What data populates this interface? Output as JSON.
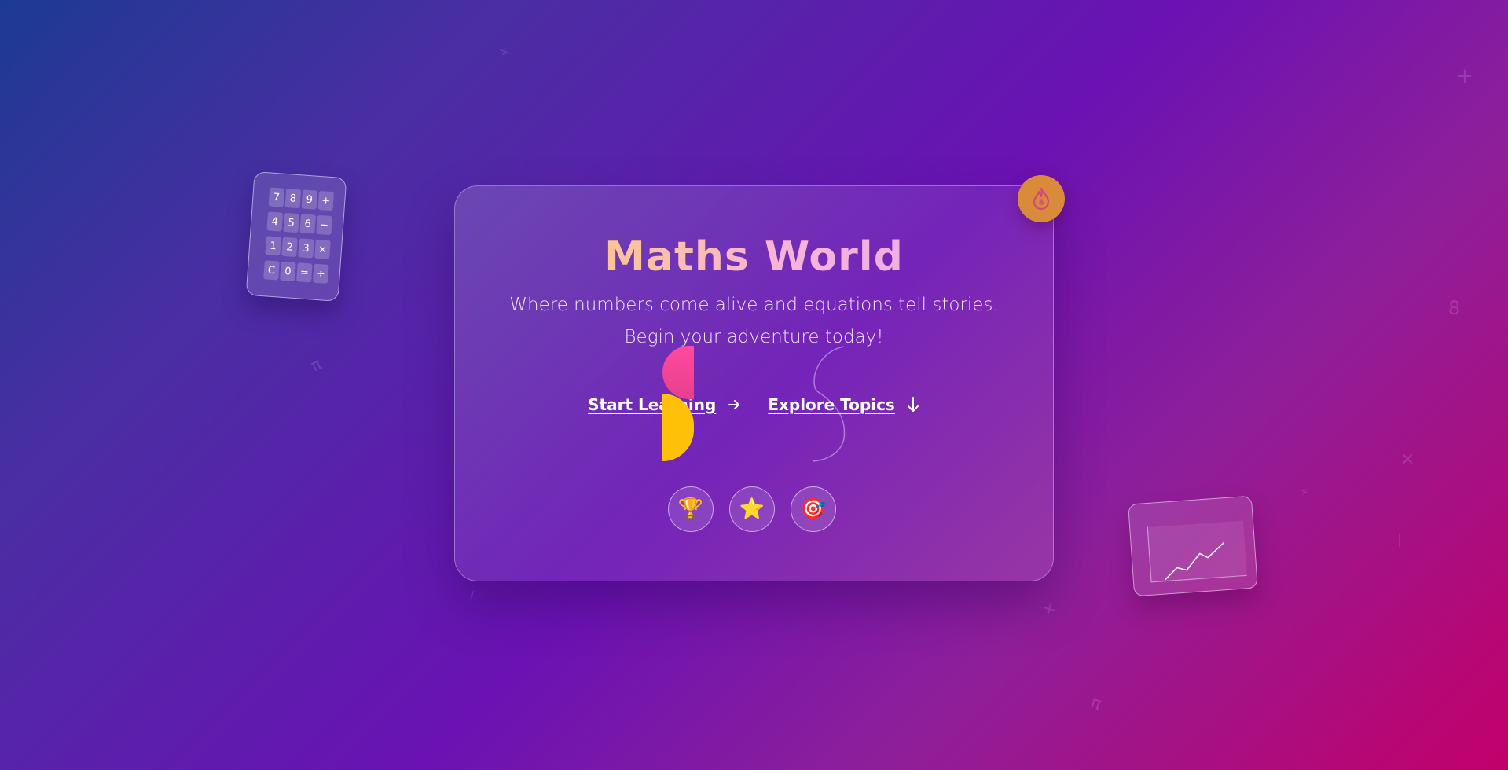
{
  "hero": {
    "title": "Maths World",
    "subtitle": "Where numbers come alive and equations tell stories. Begin your adventure today!",
    "primary_cta": "Start Learning",
    "secondary_cta": "Explore Topics",
    "badge_icon": "fire-icon"
  },
  "achievements": [
    {
      "icon": "trophy-icon",
      "glyph": "🏆"
    },
    {
      "icon": "star-icon",
      "glyph": "⭐"
    },
    {
      "icon": "target-icon",
      "glyph": "🎯"
    }
  ],
  "calculator": {
    "keys": [
      "7",
      "8",
      "9",
      "+",
      "4",
      "5",
      "6",
      "−",
      "1",
      "2",
      "3",
      "×",
      "C",
      "0",
      "=",
      "÷"
    ]
  },
  "background_symbols": [
    "÷",
    "+",
    "8",
    "π",
    "×",
    "÷",
    "|",
    "+",
    "π",
    "/"
  ],
  "colors": {
    "title_gradient_start": "#ffd25a",
    "title_gradient_end": "#e7a6f0",
    "badge": "#d98a3a",
    "accent_pink": "#ff4aa0",
    "accent_yellow": "#ffc107"
  }
}
